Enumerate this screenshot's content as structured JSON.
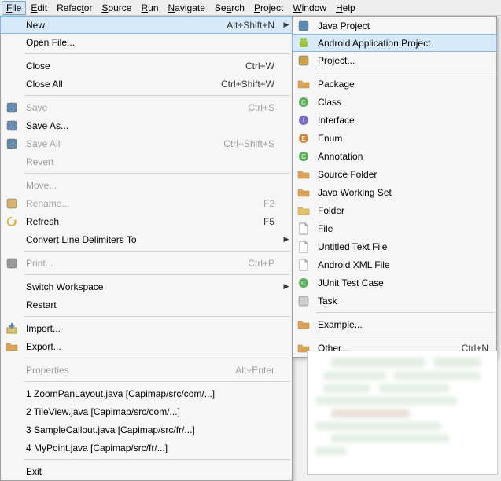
{
  "menubar": {
    "items": [
      {
        "label": "File",
        "mn": "F"
      },
      {
        "label": "Edit",
        "mn": "E"
      },
      {
        "label": "Refactor",
        "mn": ""
      },
      {
        "label": "Source",
        "mn": "S"
      },
      {
        "label": "Run",
        "mn": "R"
      },
      {
        "label": "Navigate",
        "mn": "N"
      },
      {
        "label": "Search",
        "mn": "a"
      },
      {
        "label": "Project",
        "mn": "P"
      },
      {
        "label": "Window",
        "mn": "W"
      },
      {
        "label": "Help",
        "mn": "H"
      }
    ]
  },
  "file_menu": {
    "items": [
      {
        "type": "item",
        "label": "New",
        "shortcut": "Alt+Shift+N",
        "arrow": true,
        "icon": "",
        "highlight": true,
        "name": "new"
      },
      {
        "type": "item",
        "label": "Open File...",
        "shortcut": "",
        "icon": "",
        "name": "open-file"
      },
      {
        "type": "sep"
      },
      {
        "type": "item",
        "label": "Close",
        "shortcut": "Ctrl+W",
        "icon": "",
        "name": "close"
      },
      {
        "type": "item",
        "label": "Close All",
        "shortcut": "Ctrl+Shift+W",
        "icon": "",
        "name": "close-all"
      },
      {
        "type": "sep"
      },
      {
        "type": "item",
        "label": "Save",
        "shortcut": "Ctrl+S",
        "icon": "save",
        "disabled": true,
        "name": "save"
      },
      {
        "type": "item",
        "label": "Save As...",
        "shortcut": "",
        "icon": "saveas",
        "name": "save-as"
      },
      {
        "type": "item",
        "label": "Save All",
        "shortcut": "Ctrl+Shift+S",
        "icon": "saveall",
        "disabled": true,
        "name": "save-all"
      },
      {
        "type": "item",
        "label": "Revert",
        "shortcut": "",
        "icon": "",
        "disabled": true,
        "name": "revert"
      },
      {
        "type": "sep"
      },
      {
        "type": "item",
        "label": "Move...",
        "shortcut": "",
        "icon": "",
        "disabled": true,
        "name": "move"
      },
      {
        "type": "item",
        "label": "Rename...",
        "shortcut": "F2",
        "icon": "rename",
        "disabled": true,
        "name": "rename"
      },
      {
        "type": "item",
        "label": "Refresh",
        "shortcut": "F5",
        "icon": "refresh",
        "name": "refresh"
      },
      {
        "type": "item",
        "label": "Convert Line Delimiters To",
        "shortcut": "",
        "arrow": true,
        "icon": "",
        "name": "convert-line-delim"
      },
      {
        "type": "sep"
      },
      {
        "type": "item",
        "label": "Print...",
        "shortcut": "Ctrl+P",
        "icon": "print",
        "disabled": true,
        "name": "print"
      },
      {
        "type": "sep"
      },
      {
        "type": "item",
        "label": "Switch Workspace",
        "shortcut": "",
        "arrow": true,
        "icon": "",
        "name": "switch-workspace"
      },
      {
        "type": "item",
        "label": "Restart",
        "shortcut": "",
        "icon": "",
        "name": "restart"
      },
      {
        "type": "sep"
      },
      {
        "type": "item",
        "label": "Import...",
        "shortcut": "",
        "icon": "import",
        "name": "import"
      },
      {
        "type": "item",
        "label": "Export...",
        "shortcut": "",
        "icon": "export",
        "name": "export"
      },
      {
        "type": "sep"
      },
      {
        "type": "item",
        "label": "Properties",
        "shortcut": "Alt+Enter",
        "icon": "",
        "disabled": true,
        "name": "properties"
      },
      {
        "type": "sep"
      },
      {
        "type": "item",
        "label": "1 ZoomPanLayout.java  [Capimap/src/com/...]",
        "icon": "",
        "name": "recent-1"
      },
      {
        "type": "item",
        "label": "2 TileView.java  [Capimap/src/com/...]",
        "icon": "",
        "name": "recent-2"
      },
      {
        "type": "item",
        "label": "3 SampleCallout.java  [Capimap/src/fr/...]",
        "icon": "",
        "name": "recent-3"
      },
      {
        "type": "item",
        "label": "4 MyPoint.java  [Capimap/src/fr/...]",
        "icon": "",
        "name": "recent-4"
      },
      {
        "type": "sep"
      },
      {
        "type": "item",
        "label": "Exit",
        "shortcut": "",
        "icon": "",
        "name": "exit"
      }
    ]
  },
  "new_submenu": {
    "items": [
      {
        "type": "item",
        "label": "Java Project",
        "icon": "java-project",
        "name": "new-java-project"
      },
      {
        "type": "item",
        "label": "Android Application Project",
        "icon": "android",
        "highlight": true,
        "name": "new-android-app"
      },
      {
        "type": "item",
        "label": "Project...",
        "icon": "project",
        "name": "new-project"
      },
      {
        "type": "sep"
      },
      {
        "type": "item",
        "label": "Package",
        "icon": "package",
        "name": "new-package"
      },
      {
        "type": "item",
        "label": "Class",
        "icon": "class",
        "name": "new-class"
      },
      {
        "type": "item",
        "label": "Interface",
        "icon": "interface",
        "name": "new-interface"
      },
      {
        "type": "item",
        "label": "Enum",
        "icon": "enum",
        "name": "new-enum"
      },
      {
        "type": "item",
        "label": "Annotation",
        "icon": "annotation",
        "name": "new-annotation"
      },
      {
        "type": "item",
        "label": "Source Folder",
        "icon": "source-folder",
        "name": "new-source-folder"
      },
      {
        "type": "item",
        "label": "Java Working Set",
        "icon": "working-set",
        "name": "new-working-set"
      },
      {
        "type": "item",
        "label": "Folder",
        "icon": "folder",
        "name": "new-folder"
      },
      {
        "type": "item",
        "label": "File",
        "icon": "file",
        "name": "new-file"
      },
      {
        "type": "item",
        "label": "Untitled Text File",
        "icon": "text-file",
        "name": "new-untitled"
      },
      {
        "type": "item",
        "label": "Android XML File",
        "icon": "android-xml",
        "name": "new-android-xml"
      },
      {
        "type": "item",
        "label": "JUnit Test Case",
        "icon": "junit",
        "name": "new-junit"
      },
      {
        "type": "item",
        "label": "Task",
        "icon": "task",
        "name": "new-task"
      },
      {
        "type": "sep"
      },
      {
        "type": "item",
        "label": "Example...",
        "icon": "example",
        "name": "new-example"
      },
      {
        "type": "sep"
      },
      {
        "type": "item",
        "label": "Other...",
        "shortcut": "Ctrl+N",
        "icon": "other",
        "name": "new-other"
      }
    ]
  },
  "icons": {
    "save": "#6a8caf",
    "saveas": "#6a8caf",
    "saveall": "#6a8caf",
    "rename": "#d9b36b",
    "refresh": "#e0b030",
    "print": "#999",
    "import": "#5b8bb5",
    "export": "#d9a35b",
    "java-project": "#5b8bb5",
    "android": "#9bc53d",
    "project": "#c9a34e",
    "package": "#d9a35b",
    "class": "#5bae5b",
    "interface": "#7a6bc9",
    "enum": "#c98a3d",
    "annotation": "#5bae5b",
    "source-folder": "#d9a35b",
    "working-set": "#d9a35b",
    "folder": "#e3c26b",
    "file": "#e8e8e8",
    "text-file": "#e8e8e8",
    "android-xml": "#e8e8e8",
    "junit": "#5bae5b",
    "task": "#cccccc",
    "example": "#d9a35b",
    "other": "#d9a35b"
  }
}
